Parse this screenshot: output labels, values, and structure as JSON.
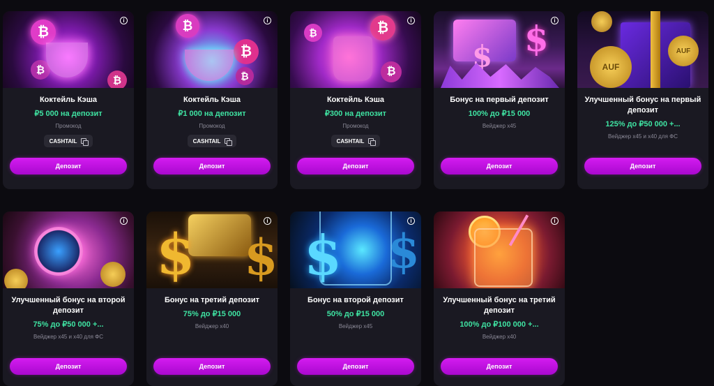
{
  "cards": [
    {
      "title": "Коктейль Кэша",
      "amount": "₽5 000 на депозит",
      "sub": "Промокод",
      "code": "CASHTAIL",
      "button": "Депозит"
    },
    {
      "title": "Коктейль Кэша",
      "amount": "₽1 000 на депозит",
      "sub": "Промокод",
      "code": "CASHTAIL",
      "button": "Депозит"
    },
    {
      "title": "Коктейль Кэша",
      "amount": "₽300 на депозит",
      "sub": "Промокод",
      "code": "CASHTAIL",
      "button": "Депозит"
    },
    {
      "title": "Бонус на первый депозит",
      "amount": "100% до ₽15 000",
      "sub": "Вейджер x45",
      "button": "Депозит"
    },
    {
      "title": "Улучшенный бонус на первый депозит",
      "amount": "125% до ₽50 000 +...",
      "sub": "Вейджер x45 и x40 для ФС",
      "button": "Депозит"
    },
    {
      "title": "Улучшенный бонус на второй депозит",
      "amount": "75% до ₽50 000 +...",
      "sub": "Вейджер x45 и x40 для ФС",
      "button": "Депозит"
    },
    {
      "title": "Бонус на третий депозит",
      "amount": "75% до ₽15 000",
      "sub": "Вейджер x40",
      "button": "Депозит"
    },
    {
      "title": "Бонус на второй депозит",
      "amount": "50% до ₽15 000",
      "sub": "Вейджер x45",
      "button": "Депозит"
    },
    {
      "title": "Улучшенный бонус на третий депозит",
      "amount": "100% до ₽100 000 +...",
      "sub": "Вейджер x40",
      "button": "Депозит"
    }
  ],
  "icons": {
    "info": "info-icon",
    "copy": "copy-icon",
    "coin_symbol": "₿",
    "dollar_symbol": "$",
    "coin_logo": "AUF"
  },
  "colors": {
    "accent": "#c812e8",
    "amount": "#3fe3a2",
    "card": "#1a1922",
    "page": "#0c0b10"
  }
}
